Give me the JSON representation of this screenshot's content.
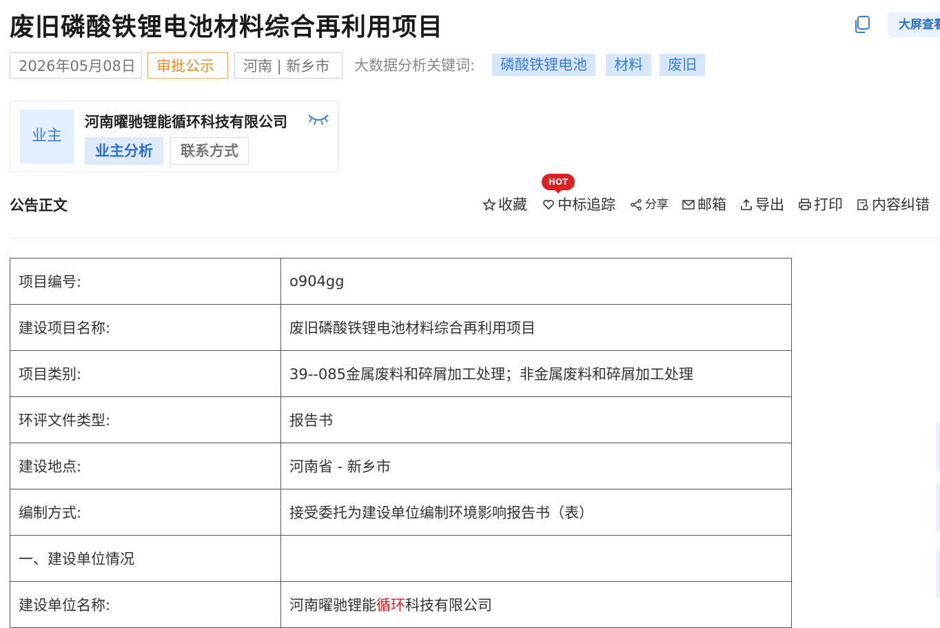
{
  "header": {
    "title": "废旧磷酸铁锂电池材料综合再利用项目",
    "big_screen_label": "大屏查看"
  },
  "tags": {
    "date": "2026年05月08日",
    "status": "审批公示",
    "region": "河南 | 新乡市",
    "keywords_label": "大数据分析关键词:",
    "keywords": [
      "磷酸铁锂电池",
      "材料",
      "废旧"
    ]
  },
  "owner": {
    "avatar_label": "业主",
    "company_name": "河南曜驰锂能循环科技有限公司",
    "analysis_button": "业主分析",
    "contact_button": "联系方式"
  },
  "notice": {
    "section_title": "公告正文",
    "hot_badge": "HOT",
    "actions": {
      "favorite": "收藏",
      "track": "中标追踪",
      "share": "分享",
      "email": "邮箱",
      "export": "导出",
      "print": "打印",
      "correct": "内容纠错"
    }
  },
  "table": {
    "rows": [
      {
        "label": "项目编号:",
        "value": "o904gg"
      },
      {
        "label": "建设项目名称:",
        "value": "废旧磷酸铁锂电池材料综合再利用项目"
      },
      {
        "label": "项目类别:",
        "value": "39--085金属废料和碎屑加工处理；非金属废料和碎屑加工处理"
      },
      {
        "label": "环评文件类型:",
        "value": "报告书"
      },
      {
        "label": "建设地点:",
        "value": "河南省 - 新乡市"
      },
      {
        "label": "编制方式:",
        "value": "接受委托为建设单位编制环境影响报告书（表）"
      },
      {
        "label": "一、建设单位情况",
        "value": ""
      },
      {
        "label": "建设单位名称:",
        "value_prefix": "河南曜驰锂能",
        "value_highlight": "循环",
        "value_suffix": "科技有限公司"
      }
    ]
  },
  "colors": {
    "accent_blue": "#2b6fd6",
    "status_orange": "#f08a24",
    "hot_red": "#e02020",
    "highlight_red": "#e02020"
  }
}
